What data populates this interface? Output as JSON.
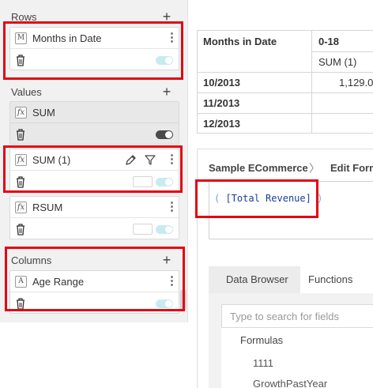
{
  "left": {
    "rows": {
      "label": "Rows",
      "add": "+",
      "card": {
        "type_icon": "M",
        "label": "Months in Date",
        "menu": "⋮"
      }
    },
    "values": {
      "label": "Values",
      "add": "+",
      "cards": [
        {
          "type_icon": "fx",
          "label": "SUM",
          "menu": "",
          "toggle": "off"
        },
        {
          "type_icon": "fx",
          "label": "SUM (1)",
          "menu": "⋮",
          "toggle": "on"
        },
        {
          "type_icon": "fx",
          "label": "RSUM",
          "menu": "⋮",
          "toggle": "on"
        }
      ]
    },
    "columns": {
      "label": "Columns",
      "add": "+",
      "card": {
        "type_icon": "A",
        "label": "Age Range",
        "menu": "⋮"
      }
    }
  },
  "table": {
    "corner_header": "Months in Date",
    "col_header": "0-18",
    "sub_header": "SUM (1)",
    "rows": [
      {
        "label": "10/2013",
        "value": "1,129.0"
      },
      {
        "label": "11/2013",
        "value": ""
      },
      {
        "label": "12/2013",
        "value": ""
      }
    ]
  },
  "editor": {
    "breadcrumb_root": "Sample ECommerce",
    "breadcrumb_sep": "〉",
    "breadcrumb_current": "Edit Form",
    "formula_open": "(",
    "formula_field": "[Total Revenue]",
    "formula_close": ")",
    "tabs": [
      "Data Browser",
      "Functions"
    ],
    "search_placeholder": "Type to search for fields",
    "list_heading": "Formulas",
    "list_items": [
      "1111",
      "GrowthPastYear"
    ]
  },
  "colors": {
    "highlight": "#e30613",
    "toggle_on": "#c8ebf0",
    "toggle_off": "#4a4a4a",
    "formula_text": "#1b3c9a"
  }
}
